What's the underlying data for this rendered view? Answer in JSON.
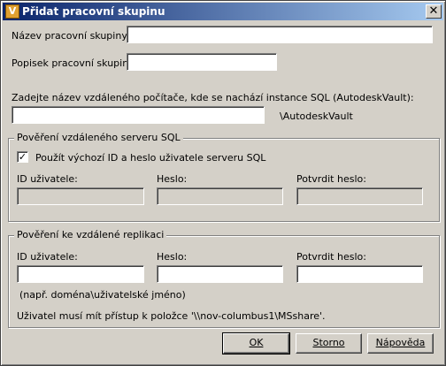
{
  "window": {
    "title": "Přidat pracovní skupinu",
    "icon_letter": "V",
    "close_glyph": "✕"
  },
  "form": {
    "group_name_label": "Název pracovní skupiny:",
    "group_name_value": "",
    "group_desc_label": "Popisek pracovní skupiny",
    "group_desc_value": "",
    "remote_computer_label": "Zadejte název vzdáleného počítače, kde se nachází instance SQL (AutodeskVault):",
    "remote_computer_value": "",
    "remote_computer_suffix": "\\AutodeskVault"
  },
  "sql_credentials": {
    "title": "Pověření vzdáleného serveru SQL",
    "use_default_label": "Použít výchozí ID a heslo uživatele serveru SQL",
    "use_default_checked": true,
    "check_glyph": "✓",
    "user_id_label": "ID uživatele:",
    "password_label": "Heslo:",
    "confirm_password_label": "Potvrdit heslo:"
  },
  "replication_credentials": {
    "title": "Pověření ke vzdálené replikaci",
    "user_id_label": "ID uživatele:",
    "password_label": "Heslo:",
    "confirm_password_label": "Potvrdit heslo:",
    "hint": "(např. doména\\uživatelské jméno)",
    "access_note": "Uživatel musí mít přístup k položce '\\\\nov-columbus1\\MSshare'."
  },
  "buttons": {
    "ok": "OK",
    "cancel": "Storno",
    "help": "Nápověda"
  }
}
